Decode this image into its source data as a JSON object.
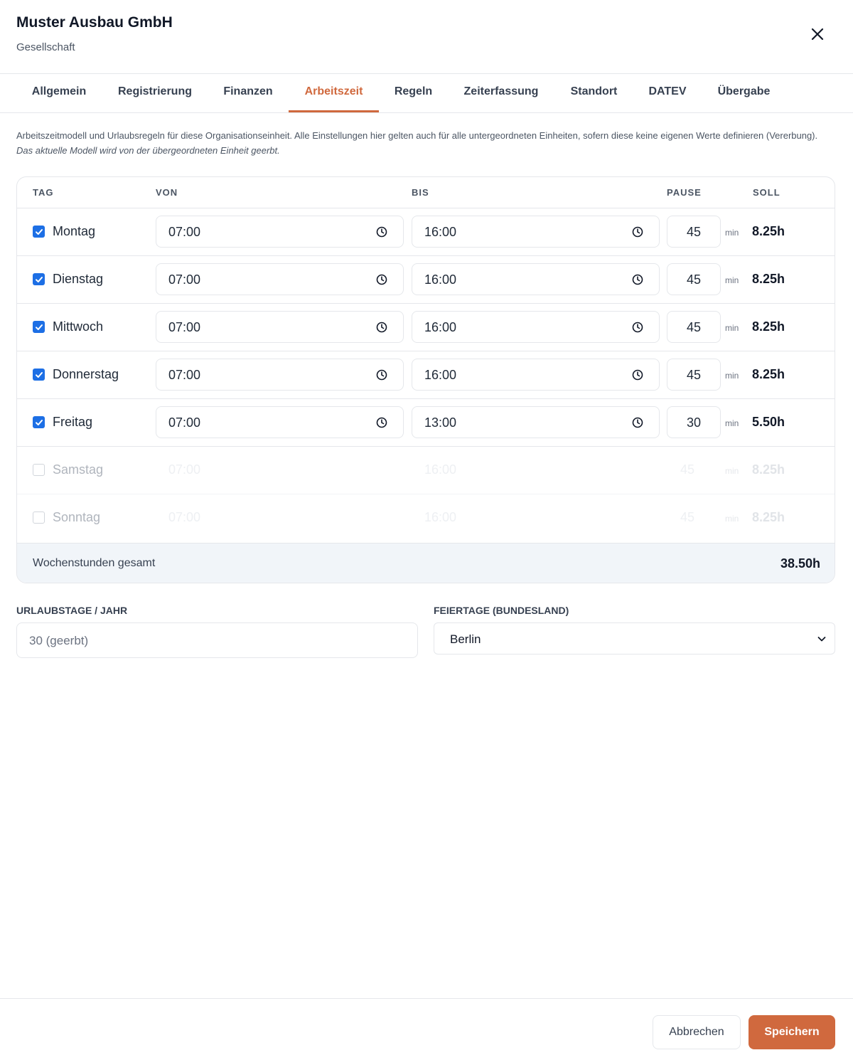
{
  "header": {
    "title": "Muster Ausbau GmbH",
    "subtitle": "Gesellschaft"
  },
  "tabs": [
    {
      "label": "Allgemein",
      "active": false
    },
    {
      "label": "Registrierung",
      "active": false
    },
    {
      "label": "Finanzen",
      "active": false
    },
    {
      "label": "Arbeitszeit",
      "active": true
    },
    {
      "label": "Regeln",
      "active": false
    },
    {
      "label": "Zeiterfassung",
      "active": false
    },
    {
      "label": "Standort",
      "active": false
    },
    {
      "label": "DATEV",
      "active": false
    },
    {
      "label": "Übergabe",
      "active": false
    }
  ],
  "intro": {
    "text": "Arbeitszeitmodell und Urlaubsregeln für diese Organisationseinheit. Alle Einstellungen hier gelten auch für alle untergeordneten Einheiten, sofern diese keine eigenen Werte definieren (Vererbung). ",
    "inherited_note": "Das aktuelle Modell wird von der übergeordneten Einheit geerbt."
  },
  "table": {
    "headers": {
      "tag": "TAG",
      "von": "VON",
      "bis": "BIS",
      "pause": "PAUSE",
      "soll": "SOLL"
    },
    "pause_unit": "min",
    "rows": [
      {
        "day": "Montag",
        "enabled": true,
        "von": "07:00",
        "bis": "16:00",
        "pause": "45",
        "soll": "8.25h"
      },
      {
        "day": "Dienstag",
        "enabled": true,
        "von": "07:00",
        "bis": "16:00",
        "pause": "45",
        "soll": "8.25h"
      },
      {
        "day": "Mittwoch",
        "enabled": true,
        "von": "07:00",
        "bis": "16:00",
        "pause": "45",
        "soll": "8.25h"
      },
      {
        "day": "Donnerstag",
        "enabled": true,
        "von": "07:00",
        "bis": "16:00",
        "pause": "45",
        "soll": "8.25h"
      },
      {
        "day": "Freitag",
        "enabled": true,
        "von": "07:00",
        "bis": "13:00",
        "pause": "30",
        "soll": "5.50h"
      },
      {
        "day": "Samstag",
        "enabled": false,
        "von": "07:00",
        "bis": "16:00",
        "pause": "45",
        "soll": "8.25h"
      },
      {
        "day": "Sonntag",
        "enabled": false,
        "von": "07:00",
        "bis": "16:00",
        "pause": "45",
        "soll": "8.25h"
      }
    ],
    "total_label": "Wochenstunden gesamt",
    "total_value": "38.50h"
  },
  "vacation": {
    "label": "URLAUBSTAGE / JAHR",
    "placeholder": "30 (geerbt)"
  },
  "holidays": {
    "label": "FEIERTAGE (BUNDESLAND)",
    "selected": "Berlin"
  },
  "actions": {
    "cancel_label": "Abbrechen",
    "save_label": "Speichern"
  },
  "colors": {
    "accent": "#d0693e",
    "checkbox": "#1d6fe5"
  },
  "icons": {
    "close": "close-icon",
    "clock": "clock-icon",
    "check": "check-icon",
    "chevron": "chevron-down-icon"
  }
}
